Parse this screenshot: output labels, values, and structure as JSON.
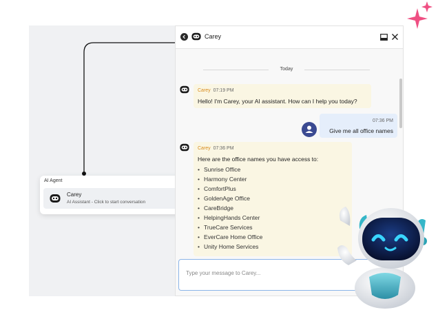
{
  "agent_card": {
    "title": "AI Agent",
    "agent_name": "Carey",
    "agent_subtitle": "AI Assistant - Click to start conversation"
  },
  "chat": {
    "header_title": "Carey",
    "date_divider": "Today",
    "messages": [
      {
        "sender": "Carey",
        "time": "07:19 PM",
        "text": "Hello! I'm Carey, your AI assistant. How can I help you today?"
      },
      {
        "sender": "user",
        "time": "07:36 PM",
        "text": "Give me all office names"
      },
      {
        "sender": "Carey",
        "time": "07:36 PM",
        "text": "Here are the office names you have access to:"
      }
    ],
    "offices": [
      "Sunrise Office",
      "Harmony Center",
      "ComfortPlus",
      "GoldenAge Office",
      "CareBridge",
      "HelpingHands Center",
      "TrueCare Services",
      "EverCare Home Office",
      "Unity Home Services"
    ],
    "input_placeholder": "Type your message to Carey..."
  },
  "colors": {
    "accent": "#3b4a91",
    "sender_name": "#d98b1c",
    "bot_bubble": "#faf6e3",
    "user_bubble": "#e5eefb",
    "sparkle": "#ef4f83"
  },
  "icons": [
    "back-arrow-icon",
    "chatbot-icon",
    "minimize-icon",
    "close-icon",
    "user-icon",
    "robot-mascot",
    "sparkle-icon"
  ]
}
